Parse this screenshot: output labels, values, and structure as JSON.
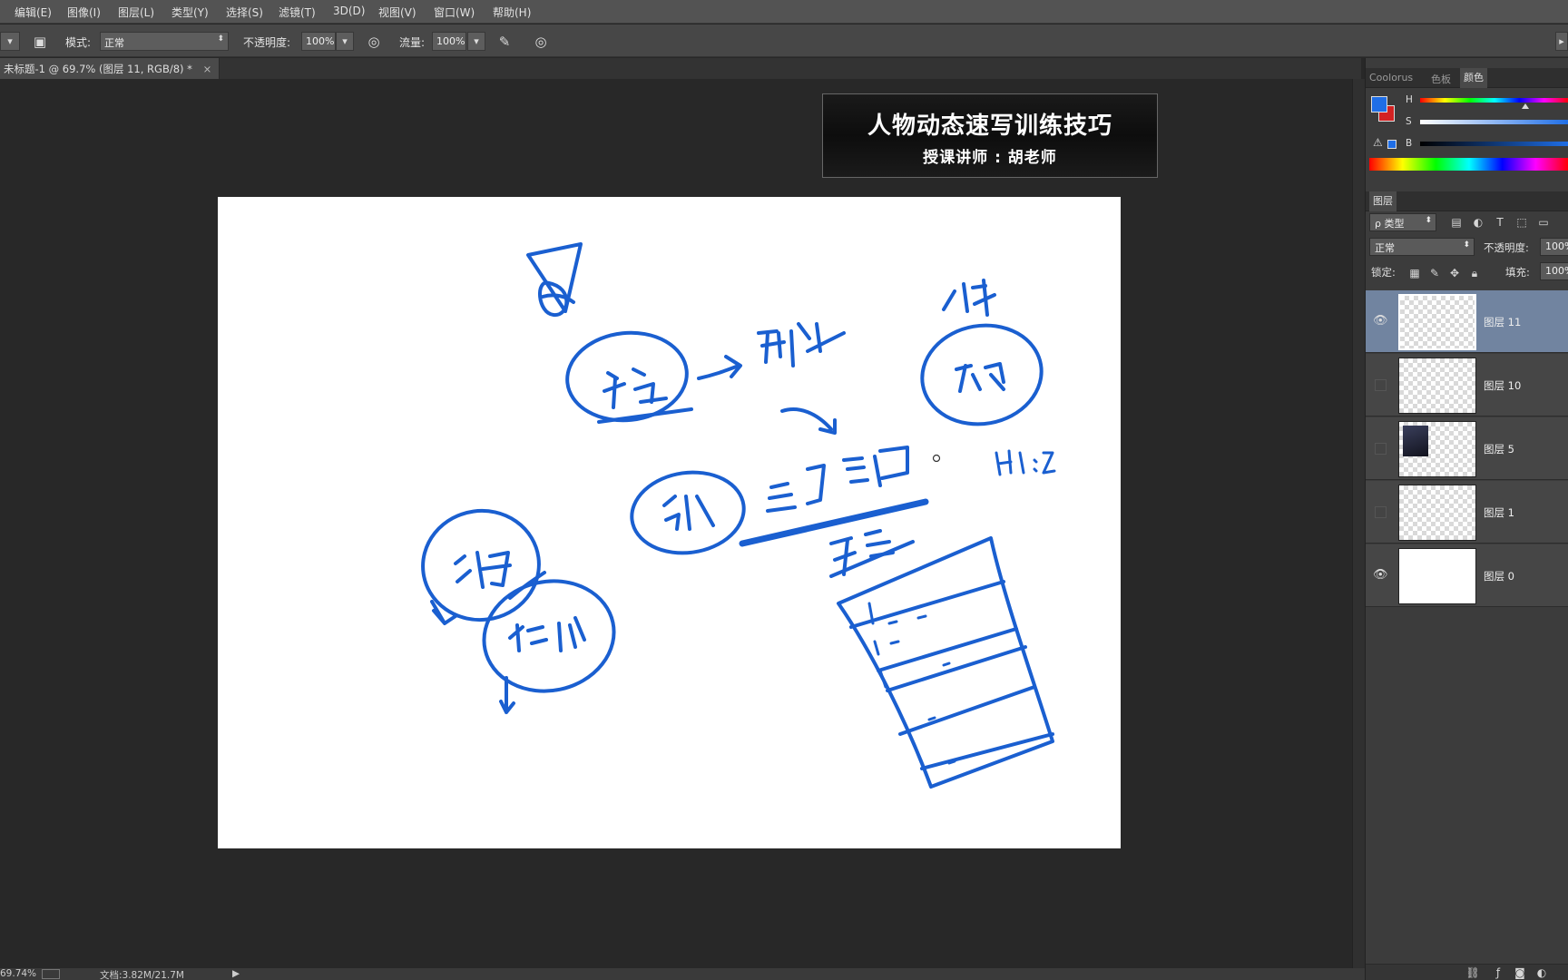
{
  "menubar": {
    "items": [
      "编辑(E)",
      "图像(I)",
      "图层(L)",
      "类型(Y)",
      "选择(S)",
      "滤镜(T)",
      "3D(D)",
      "视图(V)",
      "窗口(W)",
      "帮助(H)"
    ]
  },
  "options": {
    "mode_label": "模式:",
    "mode_value": "正常",
    "opacity_label": "不透明度:",
    "opacity_value": "100%",
    "flow_label": "流量:",
    "flow_value": "100%"
  },
  "document": {
    "tab_title": "未标题-1 @ 69.7% (图层 11, RGB/8) *",
    "close_glyph": "×"
  },
  "banner": {
    "title": "人物动态速写训练技巧",
    "subtitle": "授课讲师 : 胡老师"
  },
  "statusbar": {
    "zoom": "69.74%",
    "doc_info": "文档:3.82M/21.7M",
    "arrow": "▶"
  },
  "color_panel": {
    "tabs": [
      "Coolorus",
      "色板",
      "颜色"
    ],
    "active_tab": "颜色",
    "slider_labels": [
      "H",
      "S",
      "B"
    ],
    "foreground_color": "#1f6ee6",
    "background_color": "#d32222",
    "warning_glyph": "⚠"
  },
  "layers_panel": {
    "tab": "图层",
    "filter_label": "ρ 类型",
    "blend_mode": "正常",
    "opacity_label": "不透明度:",
    "opacity_value": "100%",
    "lock_label": "锁定:",
    "fill_label": "填充:",
    "fill_value": "100%",
    "layers": [
      {
        "name": "图层 11",
        "visible": true,
        "selected": true
      },
      {
        "name": "图层 10",
        "visible": false,
        "selected": false
      },
      {
        "name": "图层 5",
        "visible": false,
        "selected": false
      },
      {
        "name": "图层 1",
        "visible": false,
        "selected": false
      },
      {
        "name": "图层 0",
        "visible": true,
        "selected": false
      }
    ]
  },
  "sketch": {
    "ink_color": "#1a5fd0"
  }
}
